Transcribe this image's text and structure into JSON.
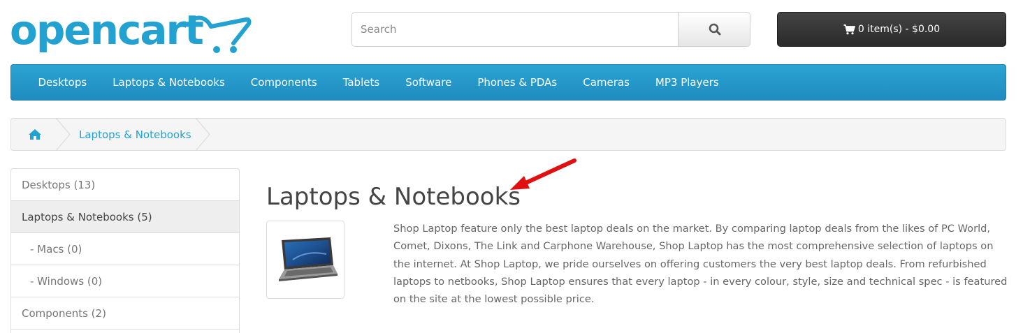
{
  "logo": {
    "text": "opencart"
  },
  "search": {
    "placeholder": "Search"
  },
  "cart": {
    "label": "0 item(s) - $0.00"
  },
  "menu": {
    "items": [
      {
        "label": "Desktops"
      },
      {
        "label": "Laptops & Notebooks"
      },
      {
        "label": "Components"
      },
      {
        "label": "Tablets"
      },
      {
        "label": "Software"
      },
      {
        "label": "Phones & PDAs"
      },
      {
        "label": "Cameras"
      },
      {
        "label": "MP3 Players"
      }
    ]
  },
  "breadcrumb": {
    "current": "Laptops & Notebooks"
  },
  "sidebar": {
    "items": [
      {
        "label": "Desktops (13)"
      },
      {
        "label": "Laptops & Notebooks (5)"
      },
      {
        "label": "- Macs (0)"
      },
      {
        "label": "- Windows (0)"
      },
      {
        "label": "Components (2)"
      }
    ]
  },
  "category": {
    "title": "Laptops & Notebooks",
    "description": "Shop Laptop feature only the best laptop deals on the market. By comparing laptop deals from the likes of PC World, Comet, Dixons, The Link and Carphone Warehouse, Shop Laptop has the most comprehensive selection of laptops on the internet. At Shop Laptop, we pride ourselves on offering customers the very best laptop deals. From refurbished laptops to netbooks, Shop Laptop ensures that every laptop - in every colour, style, size and technical spec - is featured on the site at the lowest possible price."
  },
  "colors": {
    "brand": "#23a1d1",
    "menu_bg": "#229ac8",
    "cart_bg": "#363636",
    "annotation_arrow": "#e01010"
  },
  "icons": {
    "search": "search-icon",
    "cart": "shopping-cart-icon",
    "home": "home-icon"
  }
}
